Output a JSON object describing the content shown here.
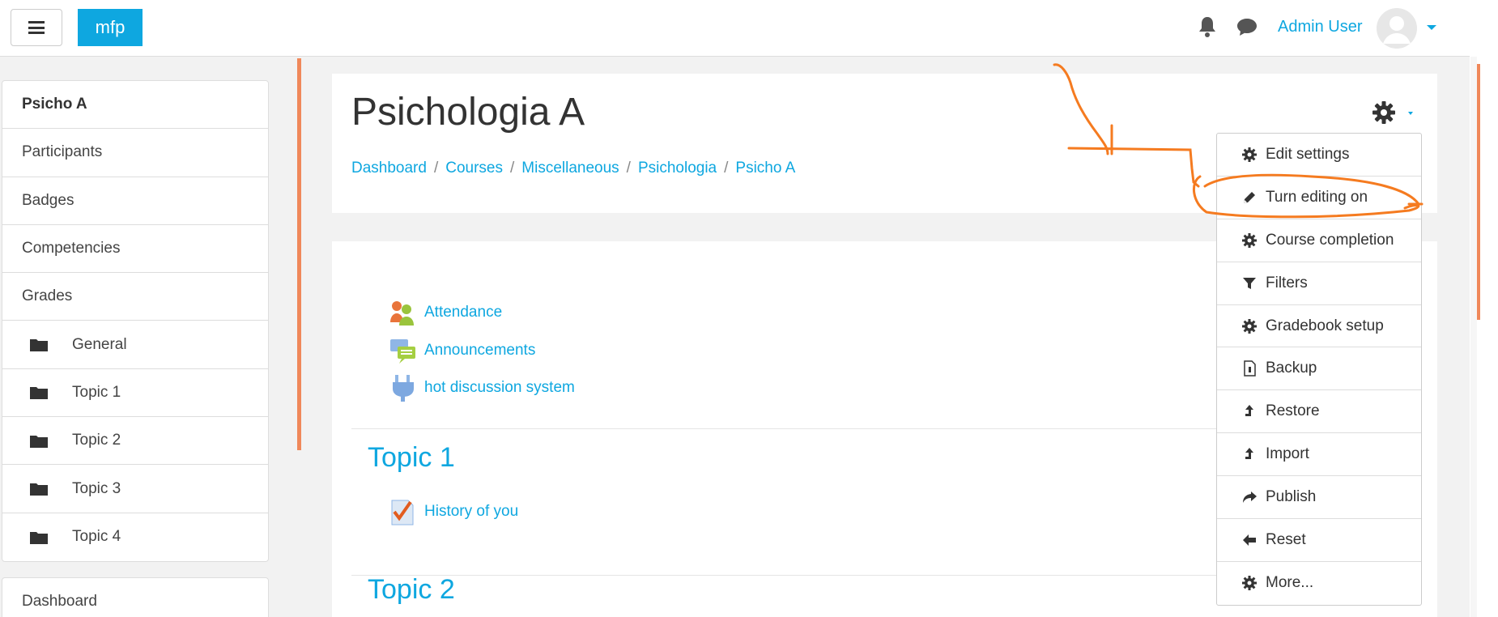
{
  "navbar": {
    "brand": "mfp",
    "user_name": "Admin User",
    "icons": [
      "hamburger-icon",
      "bell-icon",
      "chat-icon",
      "avatar",
      "caret-down-icon"
    ]
  },
  "sidebar": {
    "items": [
      {
        "label": "Psicho A",
        "bold": true
      },
      {
        "label": "Participants"
      },
      {
        "label": "Badges"
      },
      {
        "label": "Competencies"
      },
      {
        "label": "Grades"
      },
      {
        "label": "General",
        "icon": "folder-icon"
      },
      {
        "label": "Topic 1",
        "icon": "folder-icon"
      },
      {
        "label": "Topic 2",
        "icon": "folder-icon"
      },
      {
        "label": "Topic 3",
        "icon": "folder-icon"
      },
      {
        "label": "Topic 4",
        "icon": "folder-icon"
      }
    ],
    "dashboard": "Dashboard"
  },
  "header": {
    "title": "Psichologia A",
    "breadcrumb": [
      "Dashboard",
      "Courses",
      "Miscellaneous",
      "Psichologia",
      "Psicho A"
    ]
  },
  "content": {
    "general_activities": [
      "Attendance",
      "Announcements",
      "hot discussion system"
    ],
    "sections": [
      {
        "title": "Topic 1",
        "activities": [
          "History of you"
        ]
      },
      {
        "title": "Topic 2"
      }
    ]
  },
  "dropdown": {
    "items": [
      {
        "label": "Edit settings",
        "icon": "gear-icon"
      },
      {
        "label": "Turn editing on",
        "icon": "pencil-icon"
      },
      {
        "label": "Course completion",
        "icon": "gear-icon"
      },
      {
        "label": "Filters",
        "icon": "filter-icon"
      },
      {
        "label": "Gradebook setup",
        "icon": "gear-icon"
      },
      {
        "label": "Backup",
        "icon": "file-icon"
      },
      {
        "label": "Restore",
        "icon": "upload-icon"
      },
      {
        "label": "Import",
        "icon": "upload-icon"
      },
      {
        "label": "Publish",
        "icon": "share-icon"
      },
      {
        "label": "Reset",
        "icon": "arrow-left-icon"
      },
      {
        "label": "More...",
        "icon": "gear-icon"
      }
    ]
  },
  "colors": {
    "accent": "#0ea7e0",
    "annotation": "#f57b20"
  }
}
